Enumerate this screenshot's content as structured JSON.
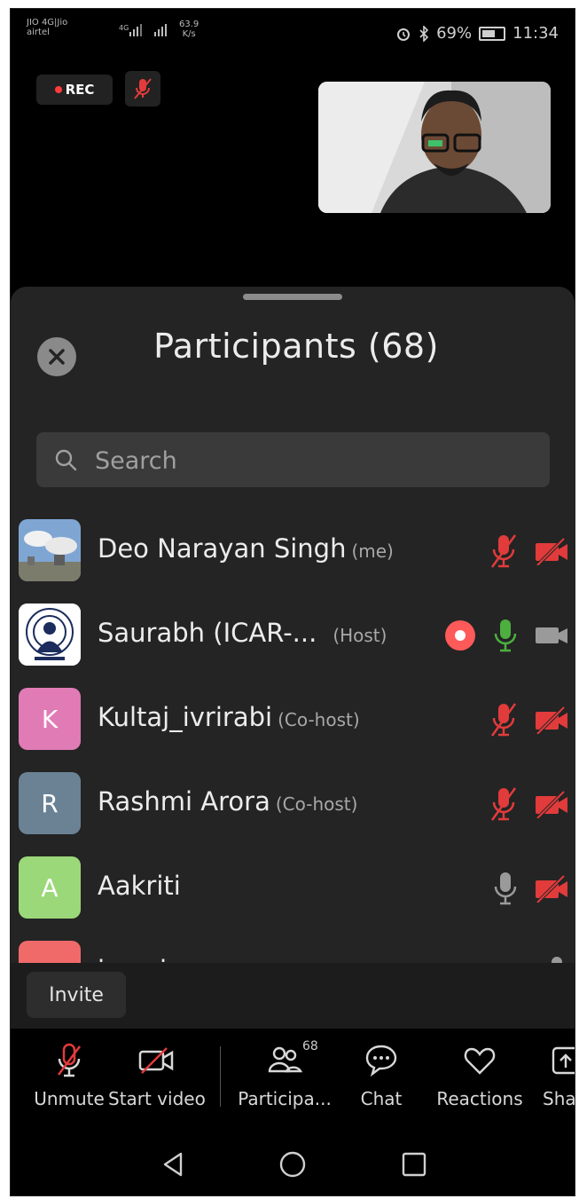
{
  "status_bar": {
    "carrier_line1": "JIO 4G|Jio",
    "carrier_line2": "airtel",
    "network": "4G",
    "speed_value": "63.9",
    "speed_unit": "K/s",
    "battery": "69%",
    "time": "11:34"
  },
  "meeting": {
    "rec_label": "REC"
  },
  "panel": {
    "title": "Participants (68)",
    "search_placeholder": "Search"
  },
  "participants": [
    {
      "name": "Deo Narayan Singh",
      "role": "(me)",
      "avatar_letter": "",
      "avatar_color": "#6b8fb5",
      "mic": "muted",
      "video": "off",
      "recording": false
    },
    {
      "name": "Saurabh (ICAR-...",
      "role": "(Host)",
      "avatar_letter": "",
      "avatar_color": "#ffffff",
      "mic": "active",
      "video": "on",
      "recording": true
    },
    {
      "name": "Kultaj_ivrirabi",
      "role": "(Co-host)",
      "avatar_letter": "K",
      "avatar_color": "#e07bb6",
      "mic": "muted",
      "video": "off",
      "recording": false
    },
    {
      "name": "Rashmi Arora",
      "role": "(Co-host)",
      "avatar_letter": "R",
      "avatar_color": "#6b8294",
      "mic": "muted",
      "video": "off",
      "recording": false
    },
    {
      "name": "Aakriti",
      "role": "",
      "avatar_letter": "A",
      "avatar_color": "#9bd879",
      "mic": "unmuted",
      "video": "off",
      "recording": false
    },
    {
      "name": "jcomice",
      "role": "",
      "avatar_letter": "J",
      "avatar_color": "#f06a6a",
      "mic": "unmuted",
      "video": "off",
      "recording": false
    }
  ],
  "invite_label": "Invite",
  "toolbar": {
    "unmute": "Unmute",
    "start_video": "Start video",
    "participants": "Participa...",
    "participants_count": "68",
    "chat": "Chat",
    "reactions": "Reactions",
    "share": "Sha"
  },
  "colors": {
    "muted_red": "#e23b3b",
    "active_green": "#4caf3f",
    "neutral_grey": "#9a9a9a",
    "record_red": "#ff5a5a"
  }
}
